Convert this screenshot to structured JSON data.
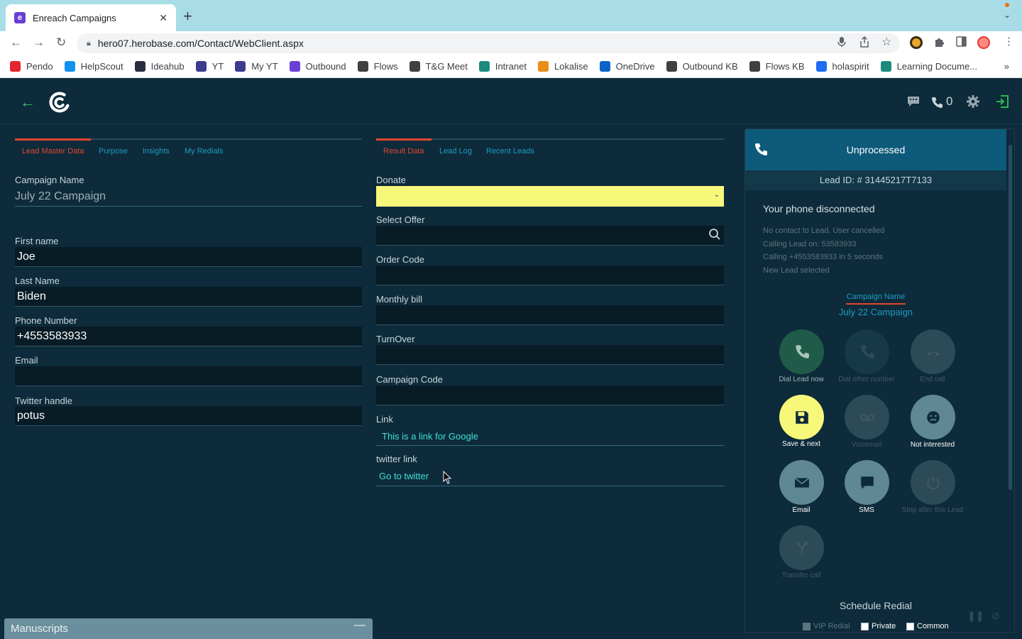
{
  "browser": {
    "tab_title": "Enreach Campaigns",
    "tab_close": "✕",
    "new_tab": "+",
    "url": "hero07.herobase.com/Contact/WebClient.aspx",
    "bookmarks": [
      {
        "label": "Pendo",
        "color": "#e3262d"
      },
      {
        "label": "HelpScout",
        "color": "#1292ee"
      },
      {
        "label": "Ideahub",
        "color": "#2b2d42"
      },
      {
        "label": "YT",
        "color": "#3b3c8e"
      },
      {
        "label": "My YT",
        "color": "#3b3c8e"
      },
      {
        "label": "Outbound",
        "color": "#6b3fd4"
      },
      {
        "label": "Flows",
        "color": "#404040"
      },
      {
        "label": "T&G Meet",
        "color": "#404040"
      },
      {
        "label": "Intranet",
        "color": "#1b8a7d"
      },
      {
        "label": "Lokalise",
        "color": "#e88d1a"
      },
      {
        "label": "OneDrive",
        "color": "#0a64c8"
      },
      {
        "label": "Outbound KB",
        "color": "#404040"
      },
      {
        "label": "Flows KB",
        "color": "#404040"
      },
      {
        "label": "holaspirit",
        "color": "#1e6cf2"
      },
      {
        "label": "Learning Docume...",
        "color": "#1b8a7d"
      }
    ],
    "bookmarks_more": "»"
  },
  "header": {
    "back_icon": "arrow-left-icon",
    "calls_count": "0"
  },
  "lead_panel": {
    "tabs": [
      "Lead Master Data",
      "Purpose",
      "Insights",
      "My Redials"
    ],
    "campaign_name_label": "Campaign Name",
    "campaign_name_value": "July 22 Campaign",
    "fields": [
      {
        "label": "First name",
        "value": "Joe"
      },
      {
        "label": "Last Name",
        "value": "Biden"
      },
      {
        "label": "Phone Number",
        "value": "+4553583933"
      },
      {
        "label": "Email",
        "value": ""
      },
      {
        "label": "Twitter handle",
        "value": "potus"
      }
    ]
  },
  "result_panel": {
    "tabs": [
      "Result Data",
      "Lead Log",
      "Recent Leads"
    ],
    "donate_label": "Donate",
    "select_offer_label": "Select Offer",
    "order_code_label": "Order Code",
    "monthly_bill_label": "Monthly bill",
    "turnover_label": "TurnOver",
    "campaign_code_label": "Campaign Code",
    "link_label": "Link",
    "link_text": "This is a link for Google",
    "twitter_link_label": "twitter link",
    "twitter_link_text": "Go to twitter",
    "accent_yellow": "#f7f77a"
  },
  "manuscripts": {
    "label": "Manuscripts",
    "minimize": "—"
  },
  "call_panel": {
    "status": "Unprocessed",
    "lead_id": "Lead ID: # 31445217T7133",
    "phone_message": "Your phone disconnected",
    "log": [
      "No contact to Lead. User cancelled",
      "Calling Lead on: 53583933",
      "Calling +4553583933 in 5 seconds",
      "New Lead selected"
    ],
    "campaign_label": "Campaign Name",
    "campaign_value": "July 22 Campaign",
    "buttons": {
      "dial": "Dial Lead now",
      "dial_other": "Dial other number",
      "end_call": "End call",
      "save_next": "Save & next",
      "voicemail": "Voicemail",
      "not_interested": "Not interested",
      "email": "Email",
      "sms": "SMS",
      "stop_after": "Stop after this Lead",
      "transfer": "Transfer call"
    },
    "schedule_label": "Schedule Redial",
    "checkboxes": [
      "VIP Redial",
      "Private",
      "Common"
    ]
  }
}
